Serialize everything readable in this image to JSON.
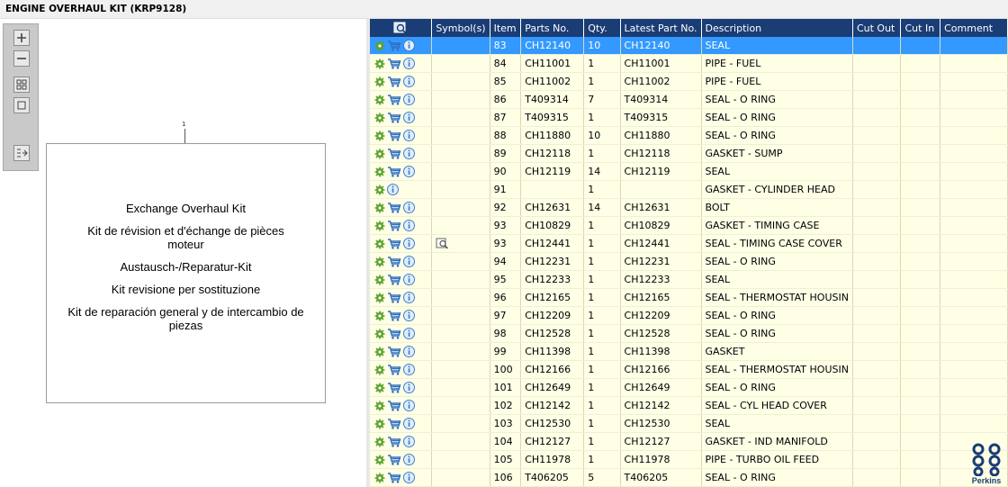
{
  "window": {
    "title": "ENGINE OVERHAUL KIT (KRP9128)"
  },
  "toolbar": {
    "buttons": [
      "zoom-in",
      "zoom-out",
      "view-all",
      "fit-window",
      "toggle-layout"
    ]
  },
  "drawing": {
    "callout": "1",
    "lines": [
      "Exchange Overhaul Kit",
      "Kit de révision et d'échange de pièces moteur",
      "Austausch-/Reparatur-Kit",
      "Kit revisione per sostituzione",
      "Kit de reparación general y de intercambio de piezas"
    ]
  },
  "table": {
    "headers": [
      "Symbol(s)",
      "Item",
      "Parts No.",
      "Qty.",
      "Latest Part No.",
      "Description",
      "Cut Out",
      "Cut In",
      "Comment"
    ],
    "rows": [
      {
        "item": "83",
        "part": "CH12140",
        "qty": "10",
        "latest": "CH12140",
        "desc": "SEAL",
        "cart": true,
        "symbol": false
      },
      {
        "item": "84",
        "part": "CH11001",
        "qty": "1",
        "latest": "CH11001",
        "desc": "PIPE - FUEL",
        "cart": true,
        "symbol": false
      },
      {
        "item": "85",
        "part": "CH11002",
        "qty": "1",
        "latest": "CH11002",
        "desc": "PIPE - FUEL",
        "cart": true,
        "symbol": false
      },
      {
        "item": "86",
        "part": "T409314",
        "qty": "7",
        "latest": "T409314",
        "desc": "SEAL - O RING",
        "cart": true,
        "symbol": false
      },
      {
        "item": "87",
        "part": "T409315",
        "qty": "1",
        "latest": "T409315",
        "desc": "SEAL - O RING",
        "cart": true,
        "symbol": false
      },
      {
        "item": "88",
        "part": "CH11880",
        "qty": "10",
        "latest": "CH11880",
        "desc": "SEAL - O RING",
        "cart": true,
        "symbol": false
      },
      {
        "item": "89",
        "part": "CH12118",
        "qty": "1",
        "latest": "CH12118",
        "desc": "GASKET - SUMP",
        "cart": true,
        "symbol": false
      },
      {
        "item": "90",
        "part": "CH12119",
        "qty": "14",
        "latest": "CH12119",
        "desc": "SEAL",
        "cart": true,
        "symbol": false
      },
      {
        "item": "91",
        "part": "",
        "qty": "1",
        "latest": "",
        "desc": "GASKET - CYLINDER HEAD",
        "cart": false,
        "symbol": false
      },
      {
        "item": "92",
        "part": "CH12631",
        "qty": "14",
        "latest": "CH12631",
        "desc": "BOLT",
        "cart": true,
        "symbol": false
      },
      {
        "item": "93",
        "part": "CH10829",
        "qty": "1",
        "latest": "CH10829",
        "desc": "GASKET - TIMING CASE",
        "cart": true,
        "symbol": false
      },
      {
        "item": "93",
        "part": "CH12441",
        "qty": "1",
        "latest": "CH12441",
        "desc": "SEAL - TIMING CASE COVER",
        "cart": true,
        "symbol": true
      },
      {
        "item": "94",
        "part": "CH12231",
        "qty": "1",
        "latest": "CH12231",
        "desc": "SEAL - O RING",
        "cart": true,
        "symbol": false
      },
      {
        "item": "95",
        "part": "CH12233",
        "qty": "1",
        "latest": "CH12233",
        "desc": "SEAL",
        "cart": true,
        "symbol": false
      },
      {
        "item": "96",
        "part": "CH12165",
        "qty": "1",
        "latest": "CH12165",
        "desc": "SEAL - THERMOSTAT HOUSIN",
        "cart": true,
        "symbol": false
      },
      {
        "item": "97",
        "part": "CH12209",
        "qty": "1",
        "latest": "CH12209",
        "desc": "SEAL - O RING",
        "cart": true,
        "symbol": false
      },
      {
        "item": "98",
        "part": "CH12528",
        "qty": "1",
        "latest": "CH12528",
        "desc": "SEAL - O RING",
        "cart": true,
        "symbol": false
      },
      {
        "item": "99",
        "part": "CH11398",
        "qty": "1",
        "latest": "CH11398",
        "desc": "GASKET",
        "cart": true,
        "symbol": false
      },
      {
        "item": "100",
        "part": "CH12166",
        "qty": "1",
        "latest": "CH12166",
        "desc": "SEAL - THERMOSTAT HOUSIN",
        "cart": true,
        "symbol": false
      },
      {
        "item": "101",
        "part": "CH12649",
        "qty": "1",
        "latest": "CH12649",
        "desc": "SEAL - O RING",
        "cart": true,
        "symbol": false
      },
      {
        "item": "102",
        "part": "CH12142",
        "qty": "1",
        "latest": "CH12142",
        "desc": "SEAL - CYL HEAD COVER",
        "cart": true,
        "symbol": false
      },
      {
        "item": "103",
        "part": "CH12530",
        "qty": "1",
        "latest": "CH12530",
        "desc": "SEAL",
        "cart": true,
        "symbol": false
      },
      {
        "item": "104",
        "part": "CH12127",
        "qty": "1",
        "latest": "CH12127",
        "desc": "GASKET - IND MANIFOLD",
        "cart": true,
        "symbol": false
      },
      {
        "item": "105",
        "part": "CH11978",
        "qty": "1",
        "latest": "CH11978",
        "desc": "PIPE - TURBO OIL FEED",
        "cart": true,
        "symbol": false
      },
      {
        "item": "106",
        "part": "T406205",
        "qty": "5",
        "latest": "T406205",
        "desc": "SEAL - O RING",
        "cart": true,
        "symbol": false
      }
    ],
    "selected_row": 0
  },
  "brand": {
    "name": "Perkins",
    "color": "#1a3d75"
  },
  "colors": {
    "header_bg": "#1a3d75",
    "row_bg": "#ffffe6",
    "selected_bg": "#3399ff",
    "gear": "#5aa02c",
    "cart": "#2f6fc0",
    "info": "#3b7fd0"
  }
}
